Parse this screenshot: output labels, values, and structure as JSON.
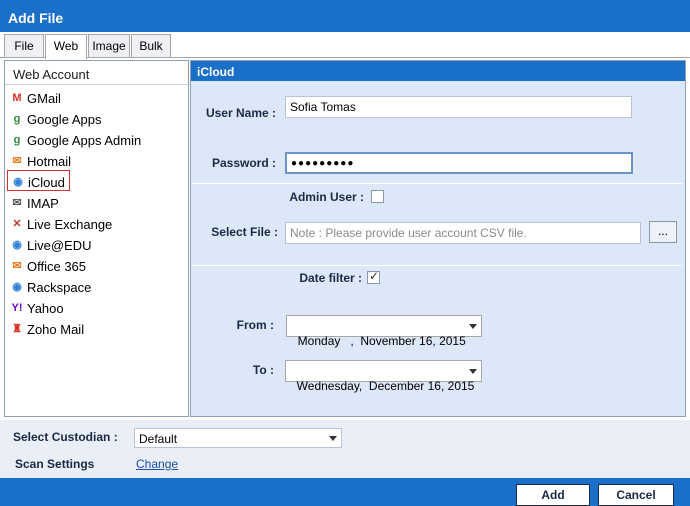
{
  "window": {
    "title": "Add File"
  },
  "tabs": [
    {
      "label": "File"
    },
    {
      "label": "Web"
    },
    {
      "label": "Image"
    },
    {
      "label": "Bulk"
    }
  ],
  "active_tab": "Web",
  "left_panel": {
    "header": "Web Account",
    "items": [
      {
        "label": "GMail",
        "icon": "gmail-icon",
        "color": "#d93025",
        "glyph": "M"
      },
      {
        "label": "Google Apps",
        "icon": "google-apps-icon",
        "color": "#2e8b3e",
        "glyph": "g"
      },
      {
        "label": "Google Apps Admin",
        "icon": "google-apps-admin-icon",
        "color": "#2e8b3e",
        "glyph": "g"
      },
      {
        "label": "Hotmail",
        "icon": "hotmail-icon",
        "color": "#f47a20",
        "glyph": "✉"
      },
      {
        "label": "iCloud",
        "icon": "icloud-icon",
        "color": "#2f7fd6",
        "glyph": "◉"
      },
      {
        "label": "IMAP",
        "icon": "imap-icon",
        "color": "#555555",
        "glyph": "✉"
      },
      {
        "label": "Live Exchange",
        "icon": "live-exchange-icon",
        "color": "#c0392b",
        "glyph": "✕"
      },
      {
        "label": "Live@EDU",
        "icon": "live-edu-icon",
        "color": "#2f7fd6",
        "glyph": "◉"
      },
      {
        "label": "Office 365",
        "icon": "office365-icon",
        "color": "#f47a20",
        "glyph": "✉"
      },
      {
        "label": "Rackspace",
        "icon": "rackspace-icon",
        "color": "#2f7fd6",
        "glyph": "◉"
      },
      {
        "label": "Yahoo",
        "icon": "yahoo-icon",
        "color": "#6b0ac9",
        "glyph": "Y!"
      },
      {
        "label": "Zoho Mail",
        "icon": "zoho-icon",
        "color": "#d93025",
        "glyph": "♜"
      }
    ],
    "selected": "iCloud"
  },
  "form": {
    "header": "iCloud",
    "user_name_label": "User Name :",
    "user_name_value": "Sofia Tomas",
    "password_label": "Password :",
    "password_value": "●●●●●●●●●",
    "admin_user_label": "Admin User :",
    "admin_user_checked": false,
    "select_file_label": "Select File :",
    "select_file_placeholder": "Note : Please provide user account CSV file.",
    "browse_label": "...",
    "date_filter_label": "Date filter :",
    "date_filter_checked": true,
    "check_glyph": "✓",
    "from_label": "From :",
    "from_value": "Monday   ,  November 16, 2015",
    "to_label": "To :",
    "to_value": "Wednesday,  December 16, 2015"
  },
  "bottom": {
    "custodian_label": "Select Custodian :",
    "custodian_value": "Default",
    "scan_settings_label": "Scan Settings",
    "change_link": "Change"
  },
  "buttons": {
    "add": "Add",
    "cancel": "Cancel"
  },
  "colors": {
    "accent": "#1a6fc9",
    "panel_bg": "#dce7f7",
    "selected_border": "#d62e2e"
  }
}
